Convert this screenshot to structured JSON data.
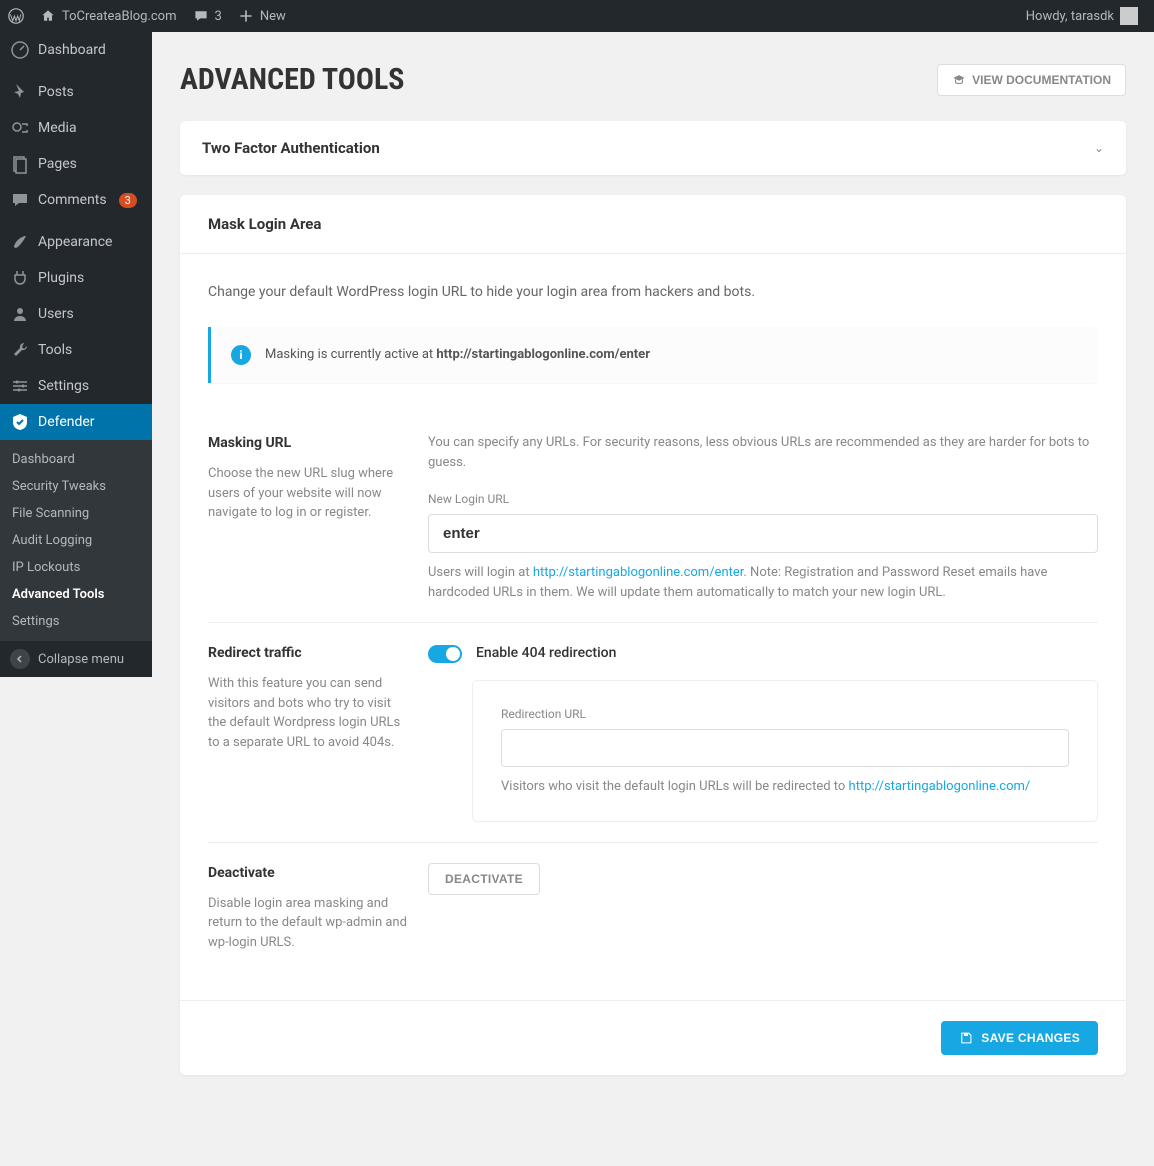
{
  "adminbar": {
    "site_name": "ToCreateaBlog.com",
    "comments_count": "3",
    "new_label": "New",
    "howdy_prefix": "Howdy, ",
    "username": "tarasdk"
  },
  "sidebar": {
    "items": [
      {
        "label": "Dashboard"
      },
      {
        "label": "Posts"
      },
      {
        "label": "Media"
      },
      {
        "label": "Pages"
      },
      {
        "label": "Comments",
        "badge": "3"
      },
      {
        "label": "Appearance"
      },
      {
        "label": "Plugins"
      },
      {
        "label": "Users"
      },
      {
        "label": "Tools"
      },
      {
        "label": "Settings"
      },
      {
        "label": "Defender"
      }
    ],
    "submenu": [
      {
        "label": "Dashboard"
      },
      {
        "label": "Security Tweaks"
      },
      {
        "label": "File Scanning"
      },
      {
        "label": "Audit Logging"
      },
      {
        "label": "IP Lockouts"
      },
      {
        "label": "Advanced Tools",
        "current": true
      },
      {
        "label": "Settings"
      }
    ],
    "collapse_label": "Collapse menu"
  },
  "page": {
    "title": "ADVANCED TOOLS",
    "doc_button": "VIEW DOCUMENTATION"
  },
  "two_factor": {
    "title": "Two Factor Authentication"
  },
  "mask": {
    "title": "Mask Login Area",
    "intro": "Change your default WordPress login URL to hide your login area from hackers and bots.",
    "notice_prefix": "Masking is currently active at ",
    "notice_url": "http://startingablogonline.com/enter",
    "masking_url": {
      "heading": "Masking URL",
      "desc": "Choose the new URL slug where users of your website will now navigate to log in or register.",
      "hint": "You can specify any URLs. For security reasons, less obvious URLs are recommended as they are harder for bots to guess.",
      "field_label": "New Login URL",
      "value": "enter",
      "helper_prefix": "Users will login at ",
      "helper_url": "http://startingablogonline.com/enter",
      "helper_suffix": ". Note: Registration and Password Reset emails have hardcoded URLs in them. We will update them automatically to match your new login URL."
    },
    "redirect": {
      "heading": "Redirect traffic",
      "desc": "With this feature you can send visitors and bots who try to visit the default Wordpress login URLs to a separate URL to avoid 404s.",
      "toggle_label": "Enable 404 redirection",
      "sub_label": "Redirection URL",
      "sub_value": "",
      "helper_prefix": "Visitors who visit the default login URLs will be redirected to ",
      "helper_url": "http://startingablogonline.com/"
    },
    "deactivate": {
      "heading": "Deactivate",
      "desc": "Disable login area masking and return to the default wp-admin and wp-login URLS.",
      "button": "DEACTIVATE"
    },
    "save_button": "SAVE CHANGES"
  }
}
